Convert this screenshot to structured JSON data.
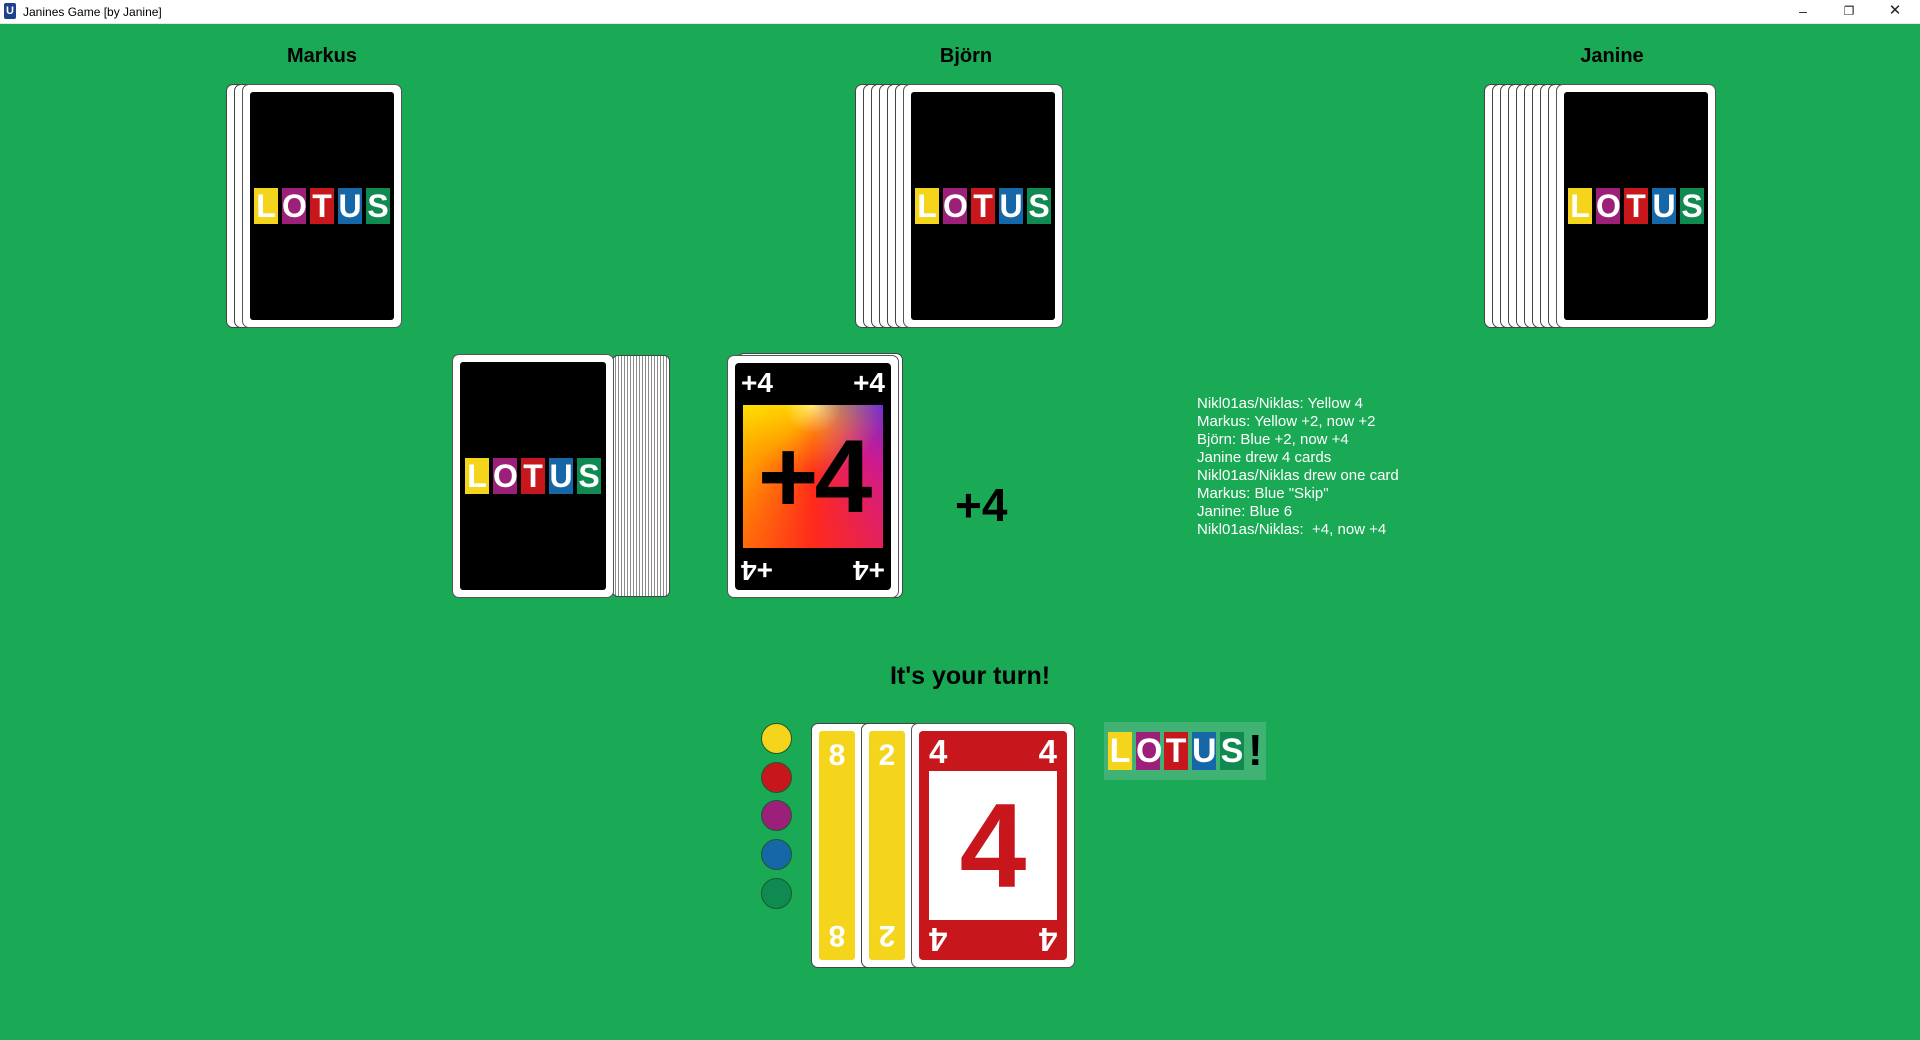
{
  "window": {
    "icon": "U",
    "title": "Janines Game [by Janine]",
    "minimize": "–",
    "maximize": "❐",
    "close": "✕"
  },
  "players": [
    {
      "name": "Markus",
      "cards": 3
    },
    {
      "name": "Björn",
      "cards": 7
    },
    {
      "name": "Janine",
      "cards": 10
    }
  ],
  "logo": {
    "letters": [
      "L",
      "O",
      "T",
      "U",
      "S"
    ],
    "colors": [
      "#f5d41c",
      "#9c1f79",
      "#c8161d",
      "#1667a8",
      "#0f8a50"
    ]
  },
  "discard": {
    "corner_top_left": "+4",
    "corner_top_right": "+4",
    "center": "+4",
    "corner_bottom_left": "+4",
    "corner_bottom_right": "+4"
  },
  "penalty": "+4",
  "log": [
    "Nikl01as/Niklas: Yellow 4",
    "Markus: Yellow +2, now +2",
    "Björn: Blue +2, now +4",
    "Janine drew 4 cards",
    "Nikl01as/Niklas drew one card",
    "Markus: Blue \"Skip\"",
    "Janine: Blue 6",
    "Nikl01as/Niklas:  +4, now +4"
  ],
  "turn_message": "It's your turn!",
  "color_choices": [
    {
      "name": "yellow",
      "color": "#f5d41c"
    },
    {
      "name": "red",
      "color": "#c8161d"
    },
    {
      "name": "purple",
      "color": "#9c1f79"
    },
    {
      "name": "blue",
      "color": "#1667a8"
    },
    {
      "name": "green",
      "color": "#0f8a50"
    }
  ],
  "hand": [
    {
      "value": "8",
      "color": "yellow"
    },
    {
      "value": "2",
      "color": "yellow"
    },
    {
      "value": "4",
      "color": "red"
    }
  ],
  "lotus_button": {
    "letters": [
      "L",
      "O",
      "T",
      "U",
      "S",
      "!"
    ],
    "colors": [
      "#f5d41c",
      "#9c1f79",
      "#c8161d",
      "#1667a8",
      "#0f8a50",
      "transparent"
    ]
  }
}
